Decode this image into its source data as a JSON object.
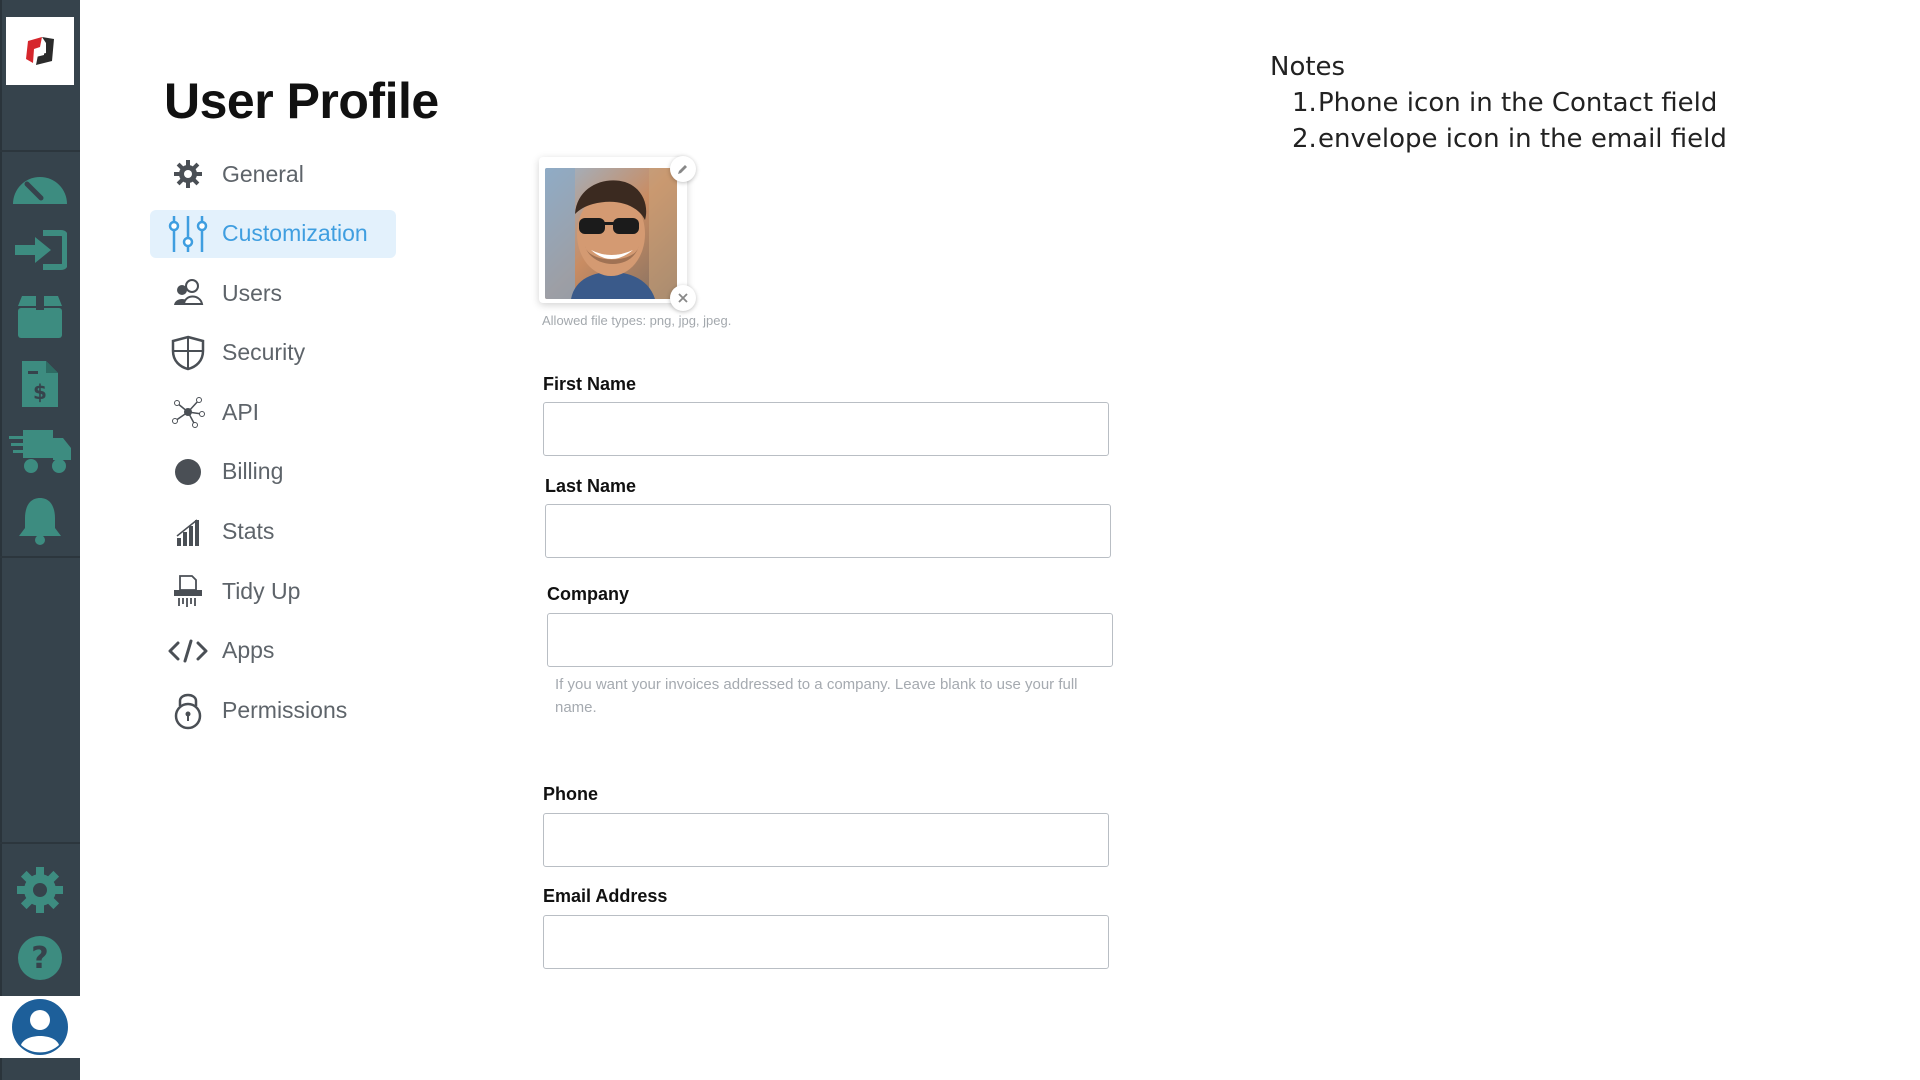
{
  "rail": {
    "logo": "app-logo",
    "icons": [
      "dashboard-icon",
      "login-icon",
      "package-icon",
      "invoice-icon",
      "delivery-truck-icon",
      "bell-icon"
    ],
    "bottom_icons": [
      "gear-icon",
      "help-icon"
    ],
    "user_icon": "user-avatar-icon",
    "color": "#36434c"
  },
  "page": {
    "title": "User Profile"
  },
  "settings_nav": {
    "items": [
      {
        "label": "General",
        "icon": "gear-icon"
      },
      {
        "label": "Customization",
        "icon": "sliders-icon",
        "active": true
      },
      {
        "label": "Users",
        "icon": "users-icon"
      },
      {
        "label": "Security",
        "icon": "shield-icon"
      },
      {
        "label": "API",
        "icon": "api-nodes-icon"
      },
      {
        "label": "Billing",
        "icon": "billing-circle-icon"
      },
      {
        "label": "Stats",
        "icon": "bar-chart-icon"
      },
      {
        "label": "Tidy Up",
        "icon": "shredder-icon"
      },
      {
        "label": "Apps",
        "icon": "code-icon"
      },
      {
        "label": "Permissions",
        "icon": "lock-icon"
      }
    ],
    "active_color": "#3f9ee0"
  },
  "avatar": {
    "allowed_types": "Allowed file types: png, jpg, jpeg.",
    "edit_icon": "pencil-icon",
    "remove_icon": "close-icon"
  },
  "form": {
    "first_name": {
      "label": "First Name",
      "value": ""
    },
    "last_name": {
      "label": "Last Name",
      "value": ""
    },
    "company": {
      "label": "Company",
      "value": "",
      "hint": "If you want your invoices addressed to a company. Leave blank to use your full name."
    },
    "phone": {
      "label": "Phone",
      "value": ""
    },
    "email": {
      "label": "Email Address",
      "value": ""
    }
  },
  "notes": {
    "title": "Notes",
    "items": [
      {
        "num": "1.",
        "text": "Phone icon in the Contact field"
      },
      {
        "num": "2.",
        "text": "envelope icon in the email field"
      }
    ]
  }
}
